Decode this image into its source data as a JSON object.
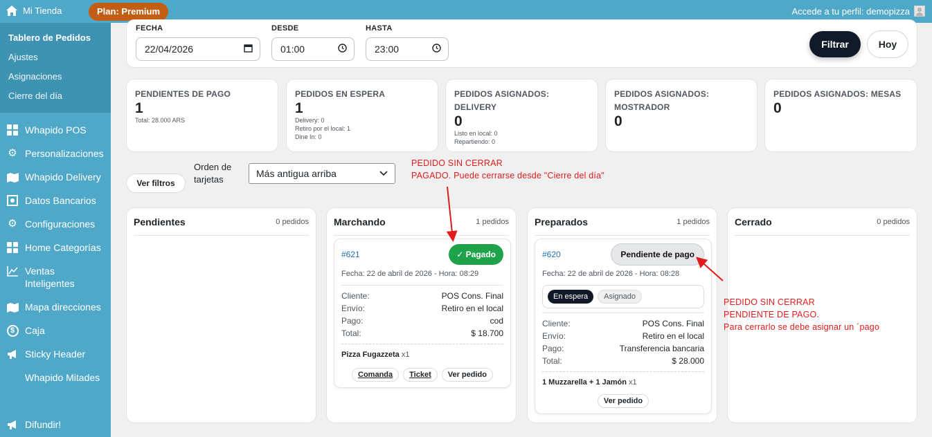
{
  "topbar": {
    "site_name": "Mi Tienda",
    "plan": "Plan: Premium",
    "profile": "Accede a tu perfil: demopizza"
  },
  "sidebar": {
    "submenu": [
      "Tablero de Pedidos",
      "Ajustes",
      "Asignaciones",
      "Cierre del día"
    ],
    "items": [
      {
        "label": "Whapido POS",
        "icon": "grid-icon"
      },
      {
        "label": "Personalizaciones",
        "icon": "gear-icon"
      },
      {
        "label": "Whapido Delivery",
        "icon": "map-icon"
      },
      {
        "label": "Datos Bancarios",
        "icon": "bank-icon"
      },
      {
        "label": "Configuraciones",
        "icon": "gear-icon"
      },
      {
        "label": "Home Categorías",
        "icon": "grid-icon"
      },
      {
        "label": "Ventas Inteligentes",
        "icon": "chart-icon"
      },
      {
        "label": "Mapa direcciones",
        "icon": "map-icon"
      },
      {
        "label": "Caja",
        "icon": "dollar-icon"
      },
      {
        "label": "Sticky Header",
        "icon": "megaphone-icon"
      },
      {
        "label": "Whapido Mitades",
        "icon": ""
      },
      {
        "label": "Difundir!",
        "icon": "megaphone-icon"
      }
    ]
  },
  "filters": {
    "fecha_label": "FECHA",
    "fecha_value": "22/04/2026",
    "desde_label": "DESDE",
    "desde_value": "01:00",
    "hasta_label": "HASTA",
    "hasta_value": "23:00",
    "filtrar": "Filtrar",
    "hoy": "Hoy"
  },
  "stats": [
    {
      "title": "PENDIENTES DE PAGO",
      "value": "1",
      "sub": [
        "Total: 28.000 ARS"
      ]
    },
    {
      "title": "PEDIDOS EN ESPERA",
      "value": "1",
      "sub": [
        "Delivery: 0",
        "Retiro por el local: 1",
        "Dine In: 0"
      ]
    },
    {
      "title": "PEDIDOS ASIGNADOS: DELIVERY",
      "value": "0",
      "sub": [
        "Listo en local: 0",
        "Repartiendo: 0"
      ]
    },
    {
      "title": "PEDIDOS ASIGNADOS: MOSTRADOR",
      "value": "0",
      "sub": []
    },
    {
      "title": "PEDIDOS ASIGNADOS: MESAS",
      "value": "0",
      "sub": []
    }
  ],
  "controls": {
    "ver_filtros": "Ver filtros",
    "orden_label": "Orden de tarjetas",
    "orden_value": "Más antigua arriba"
  },
  "columns": [
    {
      "title": "Pendientes",
      "count": "0 pedidos"
    },
    {
      "title": "Marchando",
      "count": "1 pedidos"
    },
    {
      "title": "Preparados",
      "count": "1 pedidos"
    },
    {
      "title": "Cerrado",
      "count": "0 pedidos"
    }
  ],
  "orders": {
    "o621": {
      "id": "#621",
      "badge": "✓ Pagado",
      "date": "Fecha: 22 de abril de 2026 - Hora: 08:29",
      "cliente_k": "Cliente:",
      "cliente_v": "POS Cons. Final",
      "envio_k": "Envío:",
      "envio_v": "Retiro en el local",
      "pago_k": "Pago:",
      "pago_v": "cod",
      "total_k": "Total:",
      "total_v": "$ 18.700",
      "item": "Pizza Fugazzeta",
      "qty": "x1",
      "btn_comanda": "Comanda",
      "btn_ticket": "Ticket",
      "btn_ver": "Ver pedido"
    },
    "o620": {
      "id": "#620",
      "badge": "Pendiente de pago",
      "date": "Fecha: 22 de abril de 2026 - Hora: 08:28",
      "estado_on": "En espera",
      "estado_off": "Asignado",
      "cliente_k": "Cliente:",
      "cliente_v": "POS Cons. Final",
      "envio_k": "Envío:",
      "envio_v": "Retiro en el local",
      "pago_k": "Pago:",
      "pago_v": "Transferencia bancaria",
      "total_k": "Total:",
      "total_v": "$ 28.000",
      "item": "1 Muzzarella + 1 Jamón",
      "qty": "x1",
      "btn_ver": "Ver pedido"
    }
  },
  "annotations": {
    "note1_l1": "PEDIDO SIN CERRAR",
    "note1_l2": "PAGADO. Puede cerrarse desde \"Cierre del día\"",
    "note2_l1": "PEDIDO SIN CERRAR",
    "note2_l2": "PENDIENTE DE PAGO.",
    "note2_l3": "Para cerrarlo se debe asignar un ´pago",
    "color": "#e01b1b"
  }
}
